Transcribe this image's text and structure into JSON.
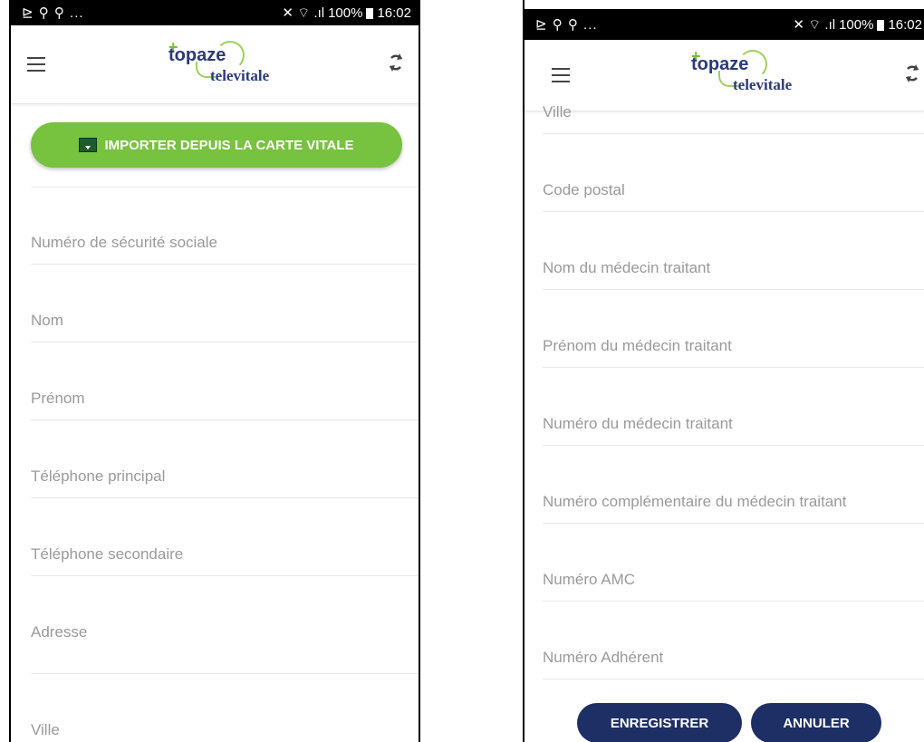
{
  "left": {
    "status": {
      "left_icons": "⊵ ⚲ ⚲ ...",
      "signal": "✕ ⌔ .ıl",
      "battery": "100%",
      "time": "16:02"
    },
    "import_button": "IMPORTER DEPUIS LA CARTE VITALE",
    "fields": [
      "Numéro de sécurité sociale",
      "Nom",
      "Prénom",
      "Téléphone principal",
      "Téléphone secondaire",
      "Adresse",
      "Ville"
    ]
  },
  "right": {
    "status": {
      "left_icons": "⊵ ⚲ ⚲ ...",
      "signal": "✕ ⌔ .ıl",
      "battery": "100%",
      "time": "16:02"
    },
    "partial_field": "Ville",
    "fields": [
      "Code postal",
      "Nom du médecin traitant",
      "Prénom du médecin traitant",
      "Numéro du médecin traitant",
      "Numéro complémentaire du médecin traitant",
      "Numéro AMC",
      "Numéro Adhérent"
    ],
    "save_button": "ENREGISTRER",
    "cancel_button": "ANNULER"
  },
  "brand": {
    "name_top": "topaze",
    "name_bottom": "televitale"
  },
  "colors": {
    "accent_green": "#77c23e",
    "primary_navy": "#1e2f66",
    "label_gray": "#9a9a9a"
  },
  "icons": [
    "menu-icon",
    "sync-icon",
    "card-reader-icon",
    "battery-icon"
  ]
}
